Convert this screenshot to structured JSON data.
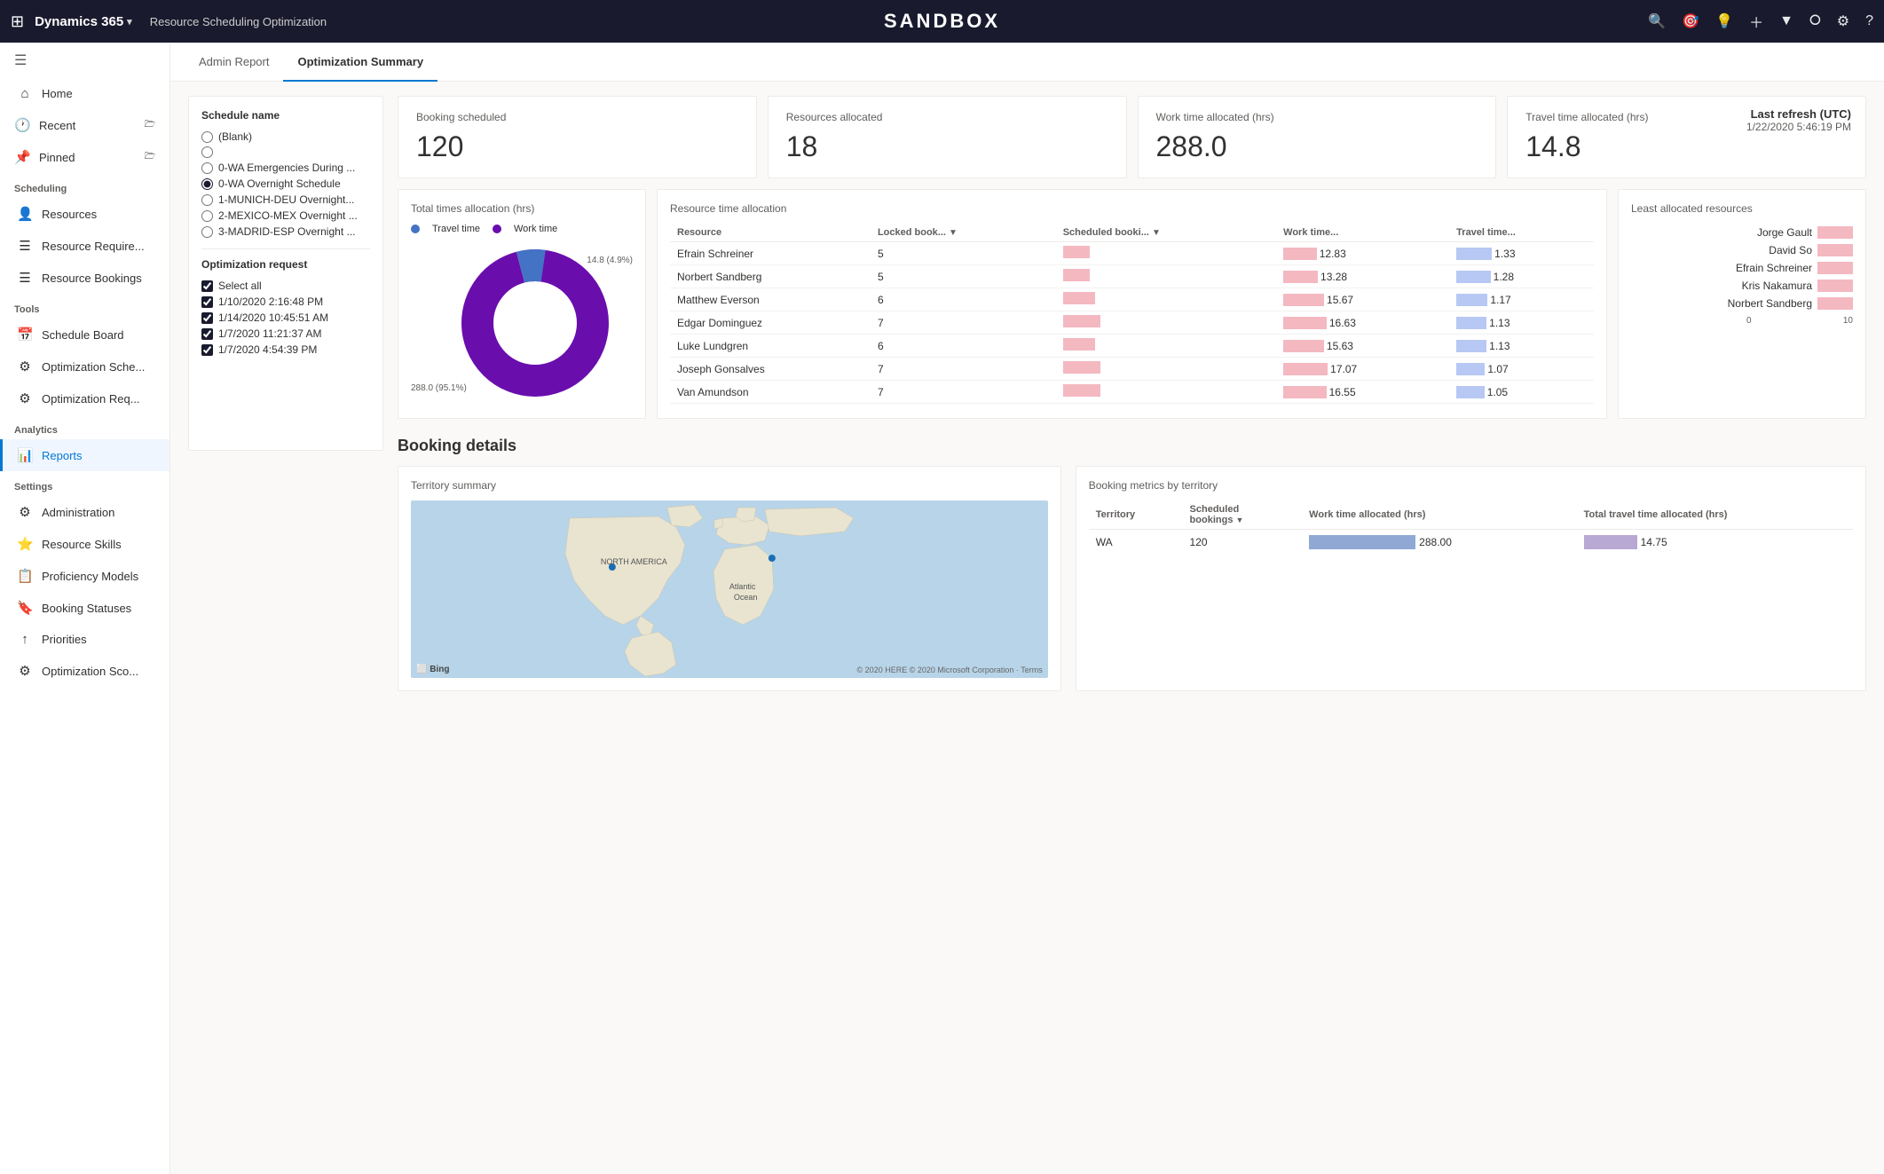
{
  "topbar": {
    "waffle": "⊞",
    "appname": "Dynamics 365",
    "chevron": "▾",
    "breadcrumb": "Resource Scheduling Optimization",
    "sandbox_title": "SANDBOX",
    "icons": [
      "🔍",
      "🎯",
      "💡",
      "＋",
      "▼",
      "⭘",
      "⚙",
      "?"
    ]
  },
  "sidebar": {
    "toggle_icon": "☰",
    "nav_groups": [
      {
        "label": "",
        "items": [
          {
            "id": "home",
            "icon": "⌂",
            "label": "Home",
            "active": false
          },
          {
            "id": "recent",
            "icon": "🕐",
            "label": "Recent",
            "active": false,
            "expand": true
          },
          {
            "id": "pinned",
            "icon": "📌",
            "label": "Pinned",
            "active": false,
            "expand": true
          }
        ]
      },
      {
        "label": "Scheduling",
        "items": [
          {
            "id": "resources",
            "icon": "👤",
            "label": "Resources",
            "active": false
          },
          {
            "id": "resource-req",
            "icon": "☰",
            "label": "Resource Require...",
            "active": false
          },
          {
            "id": "resource-bookings",
            "icon": "☰",
            "label": "Resource Bookings",
            "active": false
          }
        ]
      },
      {
        "label": "Tools",
        "items": [
          {
            "id": "schedule-board",
            "icon": "📅",
            "label": "Schedule Board",
            "active": false
          },
          {
            "id": "optimization-sche",
            "icon": "⚙",
            "label": "Optimization Sche...",
            "active": false
          },
          {
            "id": "optimization-req",
            "icon": "⚙",
            "label": "Optimization Req...",
            "active": false
          }
        ]
      },
      {
        "label": "Analytics",
        "items": [
          {
            "id": "reports",
            "icon": "📊",
            "label": "Reports",
            "active": true
          }
        ]
      },
      {
        "label": "Settings",
        "items": [
          {
            "id": "administration",
            "icon": "⚙",
            "label": "Administration",
            "active": false
          },
          {
            "id": "resource-skills",
            "icon": "⭐",
            "label": "Resource Skills",
            "active": false
          },
          {
            "id": "proficiency-models",
            "icon": "📋",
            "label": "Proficiency Models",
            "active": false
          },
          {
            "id": "booking-statuses",
            "icon": "🔖",
            "label": "Booking Statuses",
            "active": false
          },
          {
            "id": "priorities",
            "icon": "↑",
            "label": "Priorities",
            "active": false
          },
          {
            "id": "optimization-sco",
            "icon": "⚙",
            "label": "Optimization Sco...",
            "active": false
          }
        ]
      }
    ]
  },
  "tabs": [
    {
      "id": "admin-report",
      "label": "Admin Report",
      "active": false
    },
    {
      "id": "optimization-summary",
      "label": "Optimization Summary",
      "active": true
    }
  ],
  "filter": {
    "schedule_name_label": "Schedule name",
    "options": [
      {
        "id": "blank",
        "label": "(Blank)",
        "checked": false
      },
      {
        "id": "opt2",
        "label": "",
        "checked": false
      },
      {
        "id": "0wa-emerg",
        "label": "0-WA Emergencies During ...",
        "checked": false
      },
      {
        "id": "0wa-over",
        "label": "0-WA Overnight Schedule",
        "checked": true
      },
      {
        "id": "1munich",
        "label": "1-MUNICH-DEU Overnight...",
        "checked": false
      },
      {
        "id": "2mexico",
        "label": "2-MEXICO-MEX Overnight ...",
        "checked": false
      },
      {
        "id": "3madrid",
        "label": "3-MADRID-ESP Overnight ...",
        "checked": false
      }
    ],
    "opt_request_label": "Optimization request",
    "requests": [
      {
        "id": "sel-all",
        "label": "Select all",
        "checked": true
      },
      {
        "id": "r1",
        "label": "1/10/2020 2:16:48 PM",
        "checked": true
      },
      {
        "id": "r2",
        "label": "1/14/2020 10:45:51 AM",
        "checked": true
      },
      {
        "id": "r3",
        "label": "1/7/2020 11:21:37 AM",
        "checked": true
      },
      {
        "id": "r4",
        "label": "1/7/2020 4:54:39 PM",
        "checked": true
      }
    ]
  },
  "kpis": [
    {
      "id": "booking-scheduled",
      "label": "Booking scheduled",
      "value": "120"
    },
    {
      "id": "resources-allocated",
      "label": "Resources allocated",
      "value": "18"
    },
    {
      "id": "work-time",
      "label": "Work time allocated (hrs)",
      "value": "288.0"
    },
    {
      "id": "travel-time",
      "label": "Travel time allocated (hrs)",
      "value": "14.8"
    }
  ],
  "last_refresh": {
    "title": "Last refresh (UTC)",
    "value": "1/22/2020 5:46:19 PM"
  },
  "total_times": {
    "title": "Total times allocation (hrs)",
    "legend": [
      {
        "label": "Travel time",
        "color": "#4472c4"
      },
      {
        "label": "Work time",
        "color": "#7030a0"
      }
    ],
    "donut": {
      "travel_pct": 4.9,
      "work_pct": 95.1,
      "travel_val": "14.8 (4.9%)",
      "work_val": "288.0 (95.1%)",
      "travel_color": "#4472c4",
      "work_color": "#6a0dad"
    }
  },
  "resource_table": {
    "title": "Resource time allocation",
    "columns": [
      "Resource",
      "Locked book...",
      "Scheduled booki...",
      "Work time...",
      "Travel time..."
    ],
    "rows": [
      {
        "name": "Efrain Schreiner",
        "locked": 5,
        "scheduled": "",
        "work": 12.83,
        "travel": 1.33
      },
      {
        "name": "Norbert Sandberg",
        "locked": 5,
        "scheduled": "",
        "work": 13.28,
        "travel": 1.28
      },
      {
        "name": "Matthew Everson",
        "locked": 6,
        "scheduled": "",
        "work": 15.67,
        "travel": 1.17
      },
      {
        "name": "Edgar Dominguez",
        "locked": 7,
        "scheduled": "",
        "work": 16.63,
        "travel": 1.13
      },
      {
        "name": "Luke Lundgren",
        "locked": 6,
        "scheduled": "",
        "work": 15.63,
        "travel": 1.13
      },
      {
        "name": "Joseph Gonsalves",
        "locked": 7,
        "scheduled": "",
        "work": 17.07,
        "travel": 1.07
      },
      {
        "name": "Van Amundson",
        "locked": 7,
        "scheduled": "",
        "work": 16.55,
        "travel": 1.05
      }
    ]
  },
  "least_allocated": {
    "title": "Least allocated resources",
    "resources": [
      {
        "name": "Jorge Gault",
        "value": 5
      },
      {
        "name": "David So",
        "value": 5
      },
      {
        "name": "Efrain Schreiner",
        "value": 5
      },
      {
        "name": "Kris Nakamura",
        "value": 5
      },
      {
        "name": "Norbert Sandberg",
        "value": 5
      }
    ],
    "axis": [
      "0",
      "10"
    ]
  },
  "booking_details": {
    "title": "Booking details",
    "territory_summary": {
      "title": "Territory summary"
    },
    "metrics": {
      "title": "Booking metrics by territory",
      "columns": [
        "Territory",
        "Scheduled bookings",
        "Work time allocated (hrs)",
        "Total travel time allocated (hrs)"
      ],
      "rows": [
        {
          "territory": "WA",
          "scheduled": 120,
          "work": 288.0,
          "travel": 14.75
        }
      ]
    }
  }
}
